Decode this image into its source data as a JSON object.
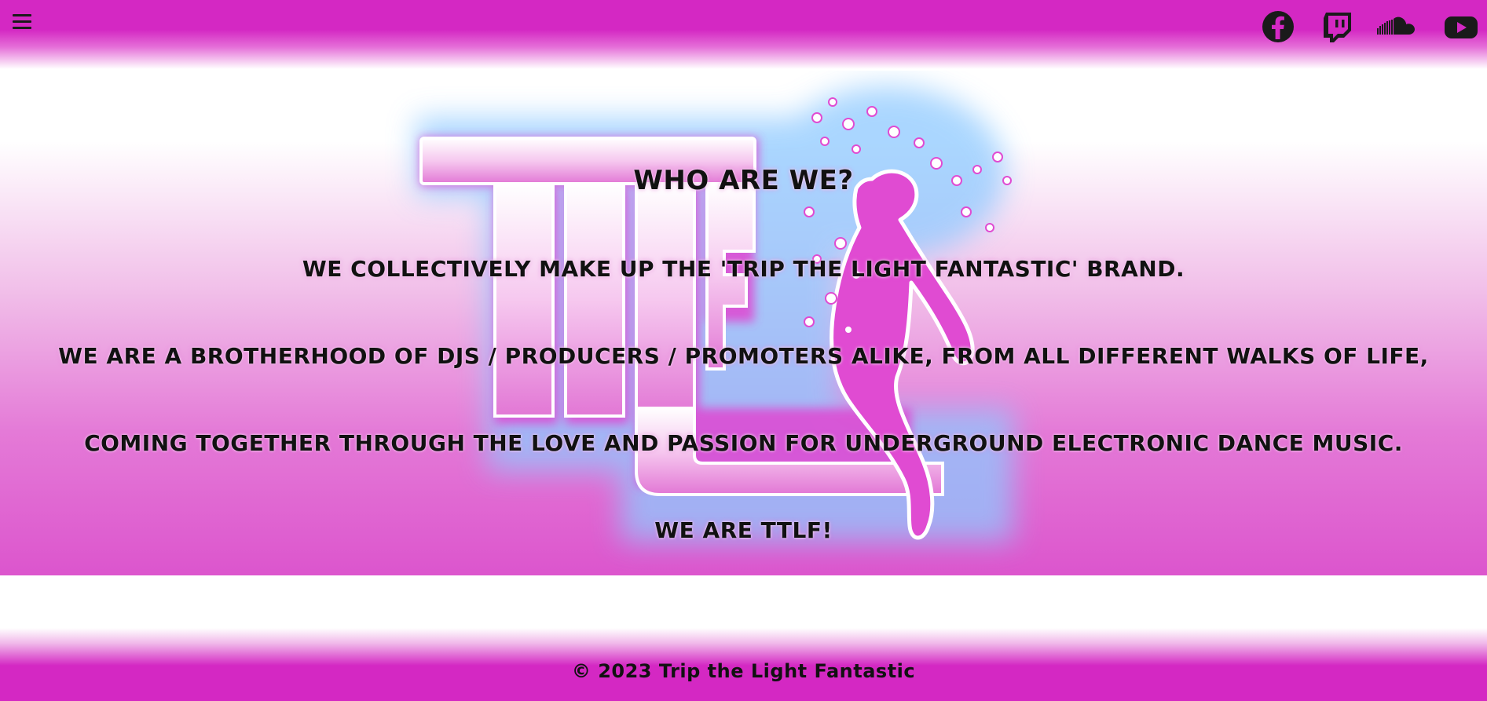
{
  "header": {
    "menu_icon": "hamburger-menu-icon",
    "social_links": [
      {
        "name": "facebook",
        "icon": "facebook-icon"
      },
      {
        "name": "twitch",
        "icon": "twitch-icon"
      },
      {
        "name": "soundcloud",
        "icon": "soundcloud-icon"
      },
      {
        "name": "youtube",
        "icon": "youtube-icon"
      }
    ]
  },
  "hero": {
    "logo": "ttlf-dancer-logo",
    "title": "WHO ARE WE?",
    "paragraphs": [
      "WE COLLECTIVELY MAKE UP THE 'TRIP THE LIGHT FANTASTIC' BRAND.",
      "WE ARE A BROTHERHOOD OF DJS / PRODUCERS / PROMOTERS ALIKE, FROM ALL DIFFERENT WALKS OF LIFE,",
      "COMING TOGETHER THROUGH THE LOVE AND PASSION FOR UNDERGROUND ELECTRONIC DANCE MUSIC.",
      "WE ARE TTLF!"
    ]
  },
  "footer": {
    "copyright": "© 2023 Trip the Light Fantastic"
  },
  "colors": {
    "brand_magenta": "#d428c3",
    "glow_blue": "#7fc4ff",
    "text": "#111111"
  }
}
